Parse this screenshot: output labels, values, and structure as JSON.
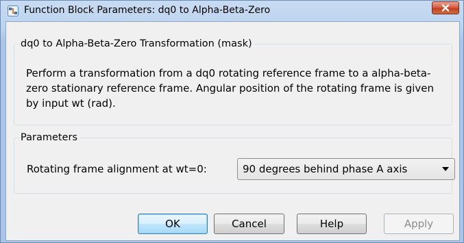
{
  "window": {
    "title": "Function Block Parameters: dq0 to Alpha-Beta-Zero"
  },
  "mask_group": {
    "legend": "dq0 to Alpha-Beta-Zero Transformation (mask)",
    "description": "Perform a transformation from a dq0 rotating reference frame to a alpha-beta-zero stationary reference frame. Angular position of the rotating frame is given by input wt (rad)."
  },
  "parameters_group": {
    "legend": "Parameters",
    "alignment_label": "Rotating frame alignment at wt=0:",
    "alignment_value": "90 degrees behind phase A axis"
  },
  "buttons": {
    "ok": "OK",
    "cancel": "Cancel",
    "help": "Help",
    "apply": "Apply"
  },
  "icons": {
    "app": "simulink-block-icon",
    "close": "close-icon",
    "dropdown": "chevron-down-icon"
  },
  "colors": {
    "title_bar": "#bcd3ee",
    "close_button": "#c2401f",
    "default_button_border": "#3c7fb1",
    "disabled_text": "#8b8b8b"
  }
}
